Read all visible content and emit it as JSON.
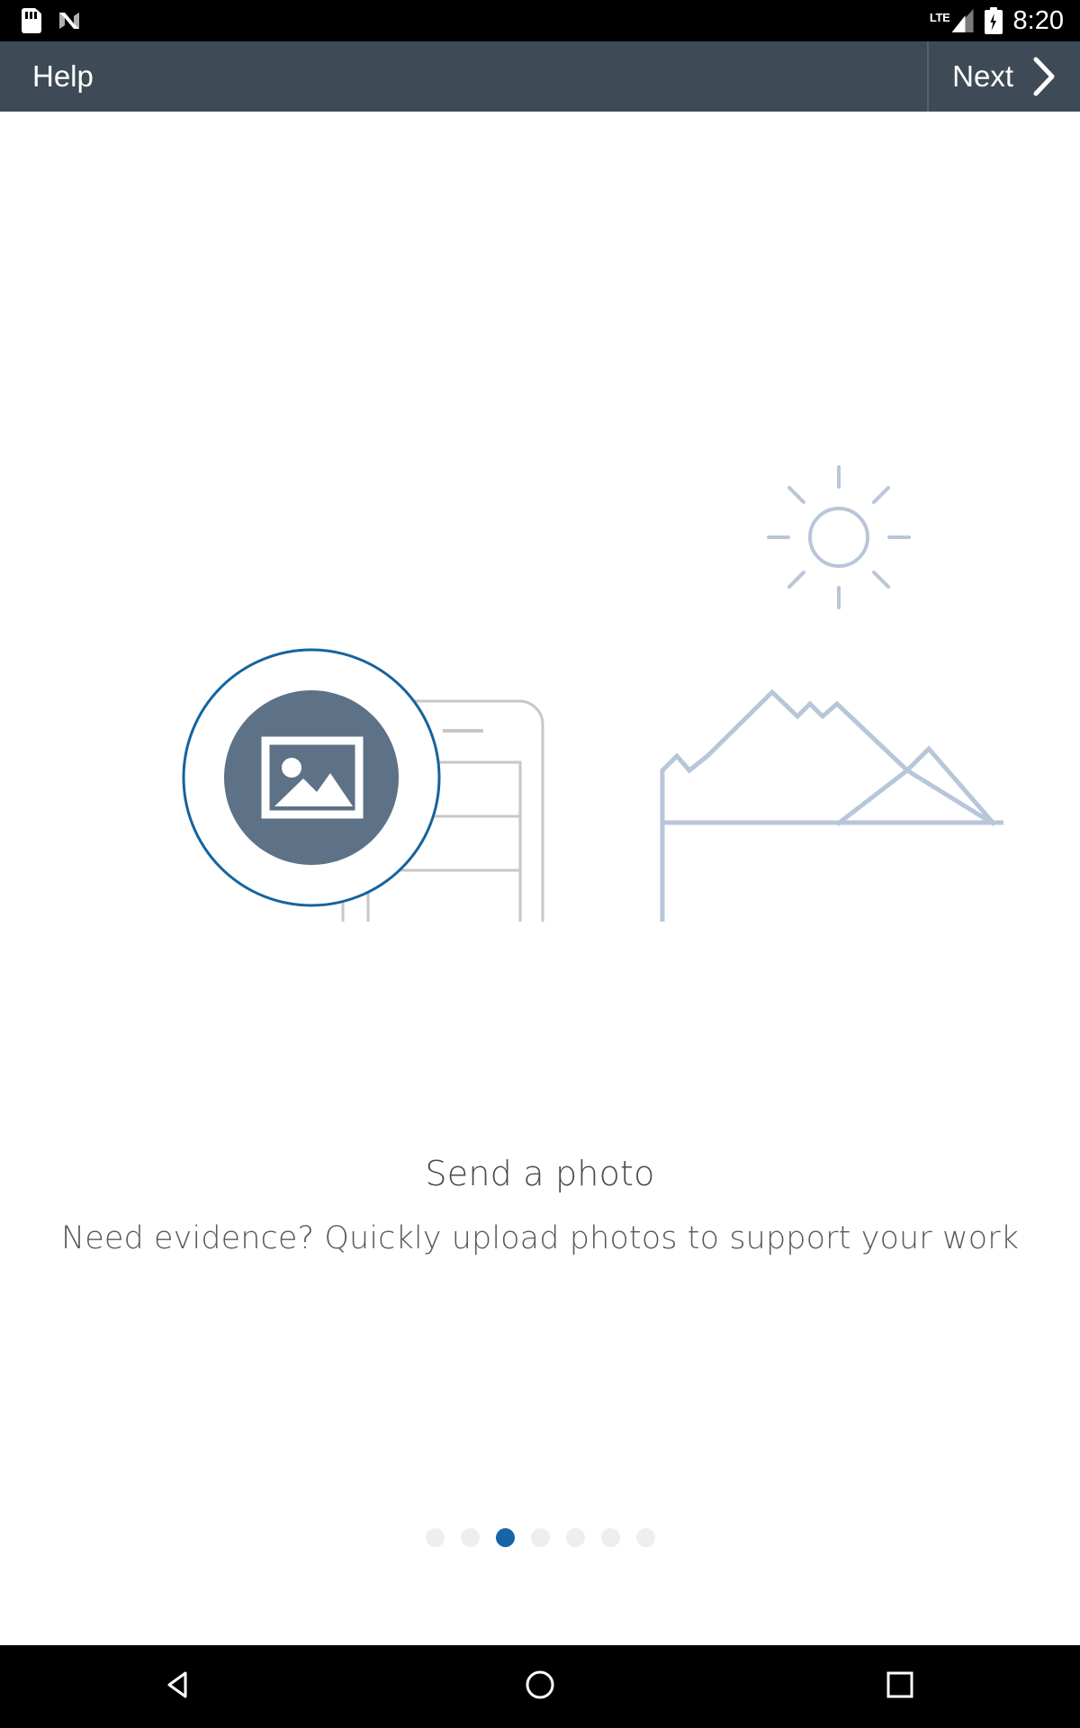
{
  "status_bar": {
    "icons": [
      "sd-card-icon",
      "nfc-icon"
    ],
    "network_label": "LTE",
    "signal_icon": "signal-triangle-icon",
    "battery_icon": "battery-charging-icon",
    "time": "8:20"
  },
  "app_bar": {
    "title": "Help",
    "next_label": "Next",
    "next_icon": "chevron-right-icon",
    "background_color": "#3e4b56"
  },
  "illustration": {
    "name": "send-a-photo-illustration",
    "photo_badge_icon": "photo-image-icon",
    "phone_icon": "smartphone-outline-icon",
    "sun_icon": "sun-icon",
    "mountains_icon": "mountains-icon",
    "accent_circle_color": "#15639e",
    "badge_fill_color": "#5d7287",
    "outline_color": "#c7c7c7",
    "scenery_color": "#b8c6d9"
  },
  "main": {
    "title": "Send a photo",
    "subtitle": "Need evidence? Quickly upload photos to support your work"
  },
  "pagination": {
    "total": 7,
    "active_index": 2,
    "active_color": "#1565a8",
    "inactive_color": "#eeeeee",
    "labels": [
      "page-1",
      "page-2",
      "page-3",
      "page-4",
      "page-5",
      "page-6",
      "page-7"
    ]
  },
  "nav_bar": {
    "back_icon": "back-triangle-icon",
    "home_icon": "home-circle-icon",
    "recents_icon": "recents-square-icon"
  }
}
